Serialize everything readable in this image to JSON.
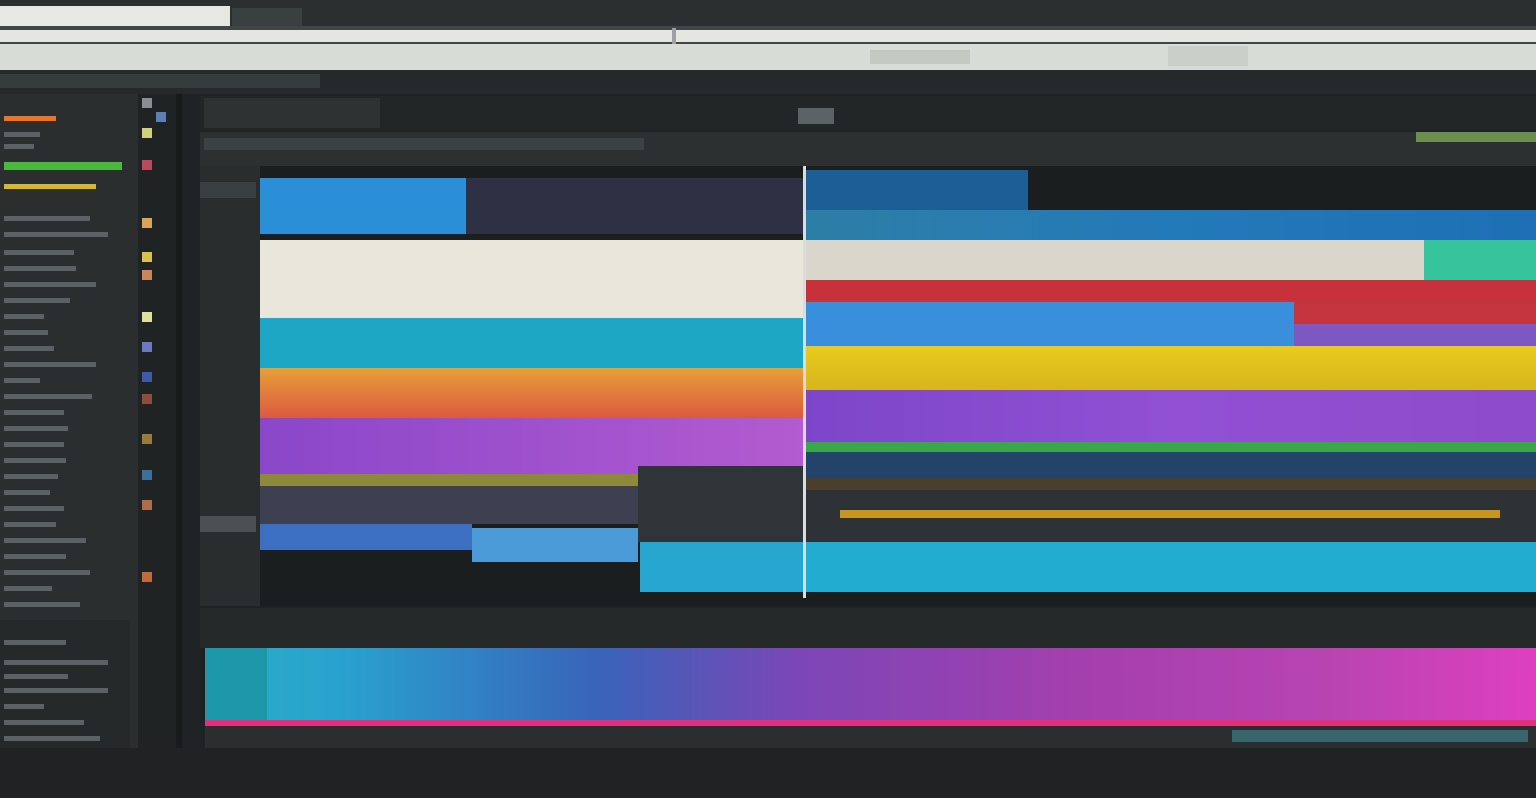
{
  "colors": {
    "orange": "#e4762f",
    "green": "#49b83b",
    "yellow": "#e2c21a",
    "teal": "#1ea6c5",
    "purple": "#8a47c9",
    "red": "#c7313b",
    "magenta": "#c53cc0",
    "cream": "#e9e6dc"
  },
  "icons": [
    "tab-close-icon",
    "scrub-marker-icon",
    "playhead-icon"
  ]
}
